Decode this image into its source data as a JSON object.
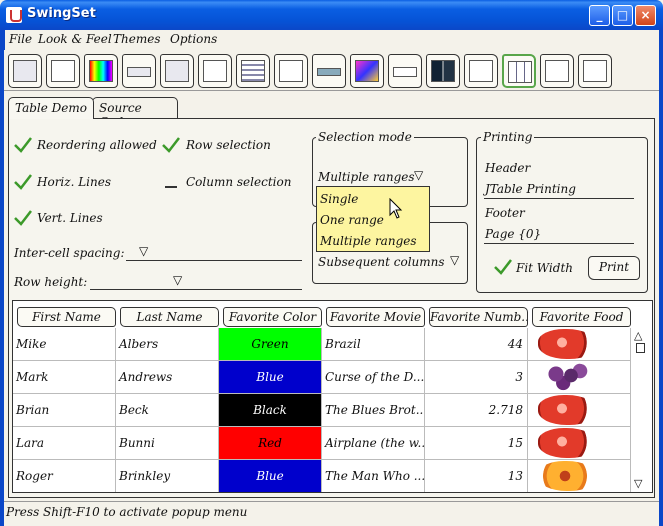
{
  "window": {
    "title": "SwingSet"
  },
  "menu": [
    "File",
    "Look & Feel",
    "Themes",
    "Options"
  ],
  "tabs": [
    "Table Demo",
    "Source Code"
  ],
  "options": {
    "reordering": "Reordering allowed",
    "row_selection": "Row selection",
    "horiz_lines": "Horiz. Lines",
    "column_selection": "Column selection",
    "vert_lines": "Vert. Lines",
    "intercell": "Inter-cell spacing:",
    "row_height": "Row height:"
  },
  "selection_mode": {
    "title": "Selection mode",
    "current": "Multiple ranges",
    "options": [
      "Single",
      "One range",
      "Multiple ranges"
    ],
    "resize_label": "Subsequent columns"
  },
  "printing": {
    "title": "Printing",
    "header_label": "Header",
    "header_value": "JTable Printing",
    "footer_label": "Footer",
    "footer_value": "Page {0}",
    "fit_width": "Fit Width",
    "print_button": "Print"
  },
  "table": {
    "columns": [
      "First Name",
      "Last Name",
      "Favorite Color",
      "Favorite Movie",
      "Favorite Numb...",
      "Favorite Food"
    ],
    "rows": [
      {
        "first": "Mike",
        "last": "Albers",
        "color": "Green",
        "color_hex": "#00ff00",
        "color_text": "#000000",
        "movie": "Brazil",
        "number": "44",
        "food": "strawberry"
      },
      {
        "first": "Mark",
        "last": "Andrews",
        "color": "Blue",
        "color_hex": "#0000cc",
        "color_text": "#ffffff",
        "movie": "Curse of the D...",
        "number": "3",
        "food": "grapes"
      },
      {
        "first": "Brian",
        "last": "Beck",
        "color": "Black",
        "color_hex": "#000000",
        "color_text": "#ffffff",
        "movie": "The Blues Brot...",
        "number": "2.718",
        "food": "strawberry"
      },
      {
        "first": "Lara",
        "last": "Bunni",
        "color": "Red",
        "color_hex": "#ff0000",
        "color_text": "#000000",
        "movie": "Airplane (the w...",
        "number": "15",
        "food": "strawberry"
      },
      {
        "first": "Roger",
        "last": "Brinkley",
        "color": "Blue",
        "color_hex": "#0000cc",
        "color_text": "#ffffff",
        "movie": "The Man Who ...",
        "number": "13",
        "food": "peach"
      }
    ]
  },
  "status": "Press Shift-F10 to activate popup menu"
}
